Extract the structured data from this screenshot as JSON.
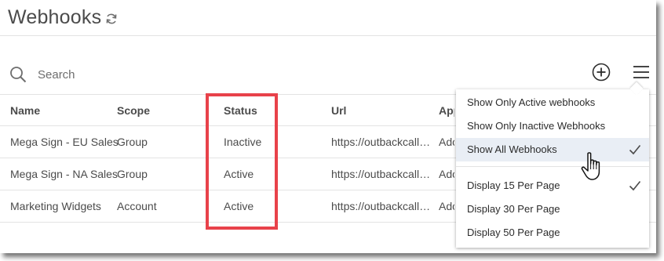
{
  "header": {
    "title": "Webhooks",
    "refresh_icon": "refresh-icon"
  },
  "search": {
    "placeholder": "Search",
    "value": "",
    "icon": "search-icon"
  },
  "toolbar": {
    "add_icon": "plus-circle-icon",
    "menu_icon": "hamburger-menu-icon"
  },
  "table": {
    "columns": [
      "Name",
      "Scope",
      "Status",
      "Url",
      "Application"
    ],
    "rows": [
      {
        "name": "Mega Sign - EU Sales",
        "scope": "Group",
        "status": "Inactive",
        "url": "https://outbackcallback.com",
        "application": "Adobe Sign"
      },
      {
        "name": "Mega Sign - NA Sales",
        "scope": "Group",
        "status": "Active",
        "url": "https://outbackcallback.com",
        "application": "Adobe Sign"
      },
      {
        "name": "Marketing Widgets",
        "scope": "Account",
        "status": "Active",
        "url": "https://outbackcallback.com",
        "application": "Adobe Sign"
      }
    ]
  },
  "dropdown": {
    "filter_items": [
      {
        "label": "Show Only Active webhooks",
        "checked": false
      },
      {
        "label": "Show Only Inactive Webhooks",
        "checked": false
      },
      {
        "label": "Show All Webhooks",
        "checked": true
      }
    ],
    "page_size_items": [
      {
        "label": "Display 15 Per Page",
        "checked": true
      },
      {
        "label": "Display 30 Per Page",
        "checked": false
      },
      {
        "label": "Display 50 Per Page",
        "checked": false
      }
    ]
  },
  "colors": {
    "highlight": "#e8424a",
    "selected_row": "#e9eef5",
    "text": "#4b4b4b"
  }
}
